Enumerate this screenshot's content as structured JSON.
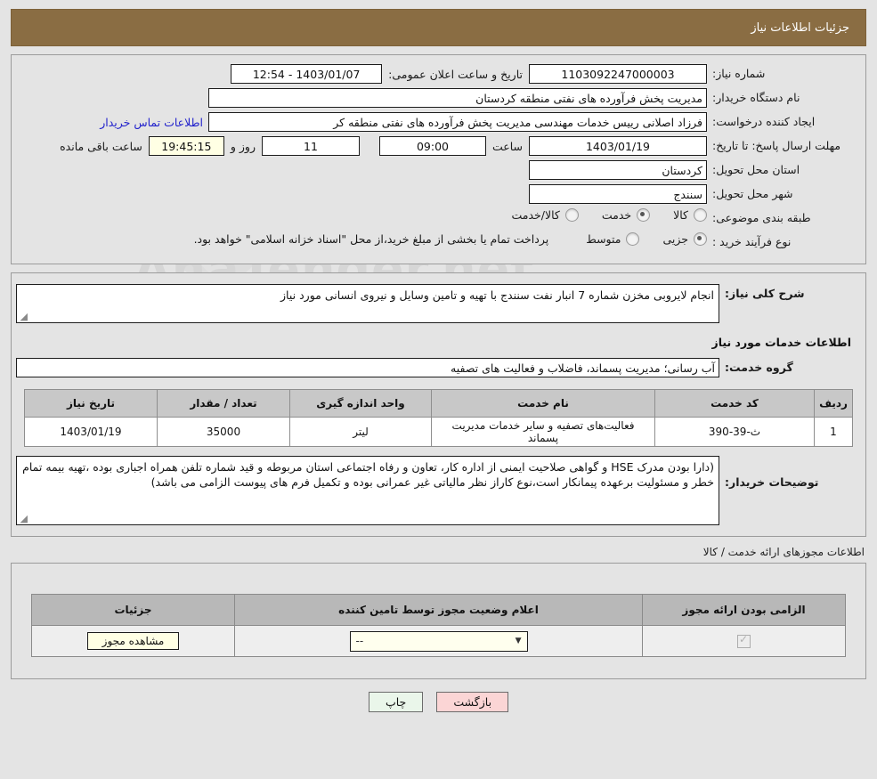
{
  "header": {
    "title": "جزئیات اطلاعات نیاز"
  },
  "form": {
    "need_number_label": "شماره نیاز:",
    "need_number": "1103092247000003",
    "announce_label": "تاریخ و ساعت اعلان عمومی:",
    "announce_value": "1403/01/07 - 12:54",
    "buyer_org_label": "نام دستگاه خریدار:",
    "buyer_org": "مدیریت پخش فرآورده های نفتی منطقه کردستان",
    "creator_label": "ایجاد کننده درخواست:",
    "creator": "فرزاد اصلانی رییس خدمات مهندسی مدیریت پخش فرآورده های نفتی منطقه کر",
    "contact_link": "اطلاعات تماس خریدار",
    "deadline_label": "مهلت ارسال پاسخ: تا تاریخ:",
    "deadline_date": "1403/01/19",
    "hour_label": "ساعت",
    "deadline_time": "09:00",
    "days_value": "11",
    "days_label": "روز و",
    "countdown": "19:45:15",
    "countdown_label": "ساعت باقی مانده",
    "province_label": "استان محل تحویل:",
    "province": "کردستان",
    "city_label": "شهر محل تحویل:",
    "city": "سنندج",
    "category_label": "طبقه بندی موضوعی:",
    "category_options": [
      {
        "label": "کالا",
        "selected": false
      },
      {
        "label": "خدمت",
        "selected": true
      },
      {
        "label": "کالا/خدمت",
        "selected": false
      }
    ],
    "process_label": "نوع فرآیند خرید :",
    "process_options": [
      {
        "label": "جزیی",
        "selected": true
      },
      {
        "label": "متوسط",
        "selected": false
      }
    ],
    "payment_note": "پرداخت تمام یا بخشی از مبلغ خرید،از محل \"اسناد خزانه اسلامی\" خواهد بود."
  },
  "description": {
    "label": "شرح کلی نیاز:",
    "text": "انجام لایروبی مخزن شماره 7 انبار نفت سنندج با تهیه و تامین وسایل و نیروی انسانی مورد نیاز"
  },
  "services": {
    "heading": "اطلاعات خدمات مورد نیاز",
    "group_label": "گروه خدمت:",
    "group_value": "آب رسانی؛ مدیریت پسماند، فاضلاب و فعالیت های تصفیه",
    "columns": [
      "ردیف",
      "کد خدمت",
      "نام خدمت",
      "واحد اندازه گیری",
      "تعداد / مقدار",
      "تاریخ نیاز"
    ],
    "rows": [
      {
        "index": "1",
        "code": "ث-39-390",
        "name": "فعالیت‌های تصفیه و سایر خدمات مدیریت پسماند",
        "unit": "لیتر",
        "quantity": "35000",
        "need_date": "1403/01/19"
      }
    ]
  },
  "buyer_notes": {
    "label": "توضیحات خریدار:",
    "text": "(دارا بودن مدرک HSE و گواهی صلاحیت ایمنی از اداره کار، تعاون و رفاه اجتماعی استان مربوطه و قید شماره تلفن همراه اجباری بوده ،تهیه بیمه تمام خطر و مسئولیت برعهده پیمانکار است،نوع کاراز نظر مالیاتی غیر عمرانی بوده و تکمیل فرم های پیوست الزامی می باشد)"
  },
  "licenses": {
    "caption": "اطلاعات مجوزهای ارائه خدمت / کالا",
    "columns": [
      "الزامی بودن ارائه مجوز",
      "اعلام وضعیت مجوز توسط تامین کننده",
      "جزئیات"
    ],
    "rows": [
      {
        "required": true,
        "status_value": "--",
        "details_button": "مشاهده مجوز"
      }
    ]
  },
  "footer": {
    "print_label": "چاپ",
    "back_label": "بازگشت"
  },
  "watermark": {
    "text": "AnaTender.net"
  }
}
